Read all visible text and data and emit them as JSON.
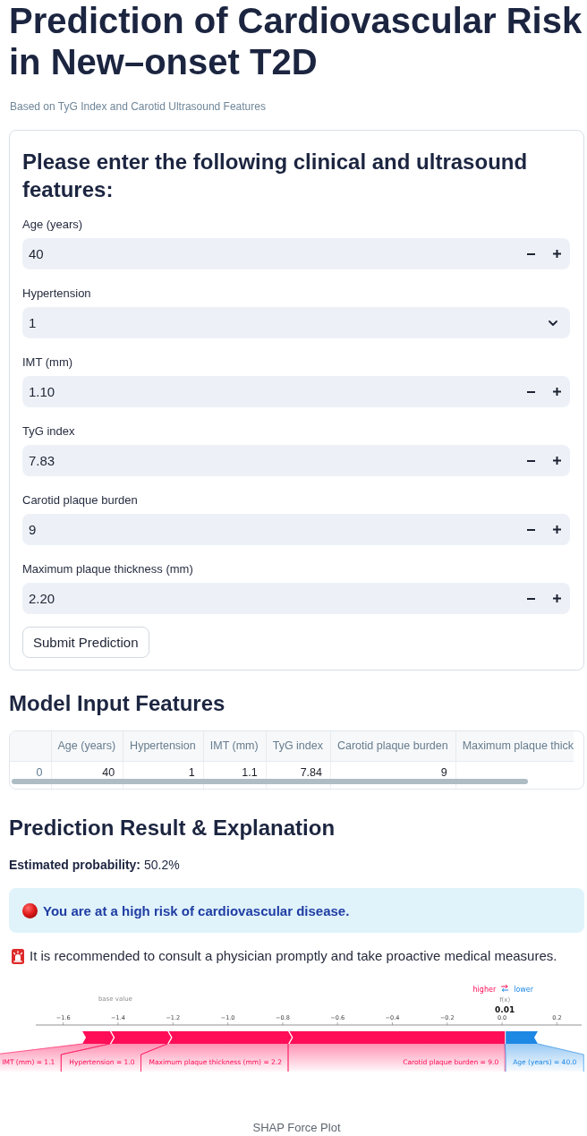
{
  "header": {
    "title": "Prediction of Cardiovascular Risk in New–onset T2D",
    "subtitle": "Based on TyG Index and Carotid Ultrasound Features"
  },
  "form": {
    "heading": "Please enter the following clinical and ultrasound features:",
    "fields": [
      {
        "label": "Age (years)",
        "kind": "number",
        "value": "40"
      },
      {
        "label": "Hypertension",
        "kind": "select",
        "value": "1"
      },
      {
        "label": "IMT (mm)",
        "kind": "number",
        "value": "1.10"
      },
      {
        "label": "TyG index",
        "kind": "number",
        "value": "7.83"
      },
      {
        "label": "Carotid plaque burden",
        "kind": "number",
        "value": "9"
      },
      {
        "label": "Maximum plaque thickness (mm)",
        "kind": "number",
        "value": "2.20"
      }
    ],
    "submit_button": "Submit Prediction"
  },
  "input_table": {
    "heading": "Model Input Features",
    "columns": [
      "Age (years)",
      "Hypertension",
      "IMT (mm)",
      "TyG index",
      "Carotid plaque burden",
      "Maximum plaque thick"
    ],
    "rows": [
      {
        "index": "0",
        "cells": [
          "40",
          "1",
          "1.1",
          "7.84",
          "9"
        ]
      }
    ]
  },
  "result": {
    "heading": "Prediction Result & Explanation",
    "probability": "**Estimated probability:** 50.2%",
    "alert": {
      "kind": "info",
      "text": "You are at a high risk of cardiovascular disease."
    },
    "recommendation": "It is recommended to consult a physician promptly and take proactive medical measures."
  },
  "force_plot": {
    "legend": [
      {
        "kind": "higher",
        "label": "higher"
      },
      {
        "kind": "lower",
        "label": "lower"
      }
    ],
    "base_value_label": "base value",
    "output_label": "f(x)",
    "output_value": "0.01",
    "axis_ticks": [
      "−1.6",
      "−1.4",
      "−1.2",
      "−1.0",
      "−0.8",
      "−0.6",
      "−0.4",
      "−0.2",
      "0.0",
      "0.2"
    ],
    "features": [
      {
        "kind": "higher",
        "label": "IMT (mm) = 1.1"
      },
      {
        "kind": "higher",
        "label": "Hypertension = 1.0"
      },
      {
        "kind": "higher",
        "label": "Maximum plaque thickness (mm) = 2.2"
      },
      {
        "kind": "higher",
        "label": "Carotid plaque burden = 9.0"
      },
      {
        "kind": "lower",
        "label": "Age (years) = 40.0"
      }
    ],
    "caption": "SHAP Force Plot"
  }
}
